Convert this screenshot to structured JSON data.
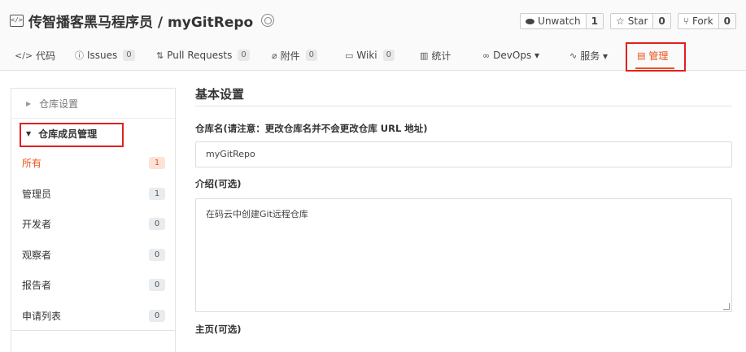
{
  "header": {
    "repo_icon": "</>",
    "title": "传智播客黑马程序员 / myGitRepo",
    "actions": [
      {
        "icon": "eye-icon",
        "label": "Unwatch",
        "count": "1"
      },
      {
        "icon": "☆",
        "label": "Star",
        "count": "0"
      },
      {
        "icon": "⑂",
        "label": "Fork",
        "count": "0"
      }
    ]
  },
  "tabs": [
    {
      "icon": "</>",
      "label": "代码",
      "count": ""
    },
    {
      "icon": "ⓘ",
      "label": "Issues",
      "count": "0"
    },
    {
      "icon": "⇅",
      "label": "Pull Requests",
      "count": "0"
    },
    {
      "icon": "⌀",
      "label": "附件",
      "count": "0"
    },
    {
      "icon": "▭",
      "label": "Wiki",
      "count": "0"
    },
    {
      "icon": "▥",
      "label": "统计",
      "count": ""
    },
    {
      "icon": "∞",
      "label": "DevOps ▾",
      "count": ""
    },
    {
      "icon": "∿",
      "label": "服务 ▾",
      "count": ""
    },
    {
      "icon": "▤",
      "label": "管理",
      "count": ""
    }
  ],
  "sidebar": {
    "section1": "仓库设置",
    "section2": "仓库成员管理",
    "items": [
      {
        "label": "所有",
        "count": "1"
      },
      {
        "label": "管理员",
        "count": "1"
      },
      {
        "label": "开发者",
        "count": "0"
      },
      {
        "label": "观察者",
        "count": "0"
      },
      {
        "label": "报告者",
        "count": "0"
      },
      {
        "label": "申请列表",
        "count": "0"
      }
    ]
  },
  "main": {
    "section_title": "基本设置",
    "name_label": "仓库名(请注意：更改仓库名并不会更改仓库 URL 地址)",
    "name_value": "myGitRepo",
    "desc_label": "介绍(可选)",
    "desc_value": "在码云中创建Git远程仓库",
    "homepage_label": "主页(可选)"
  },
  "colors": {
    "accent": "#e9541c",
    "highlight_box": "#e02020"
  }
}
